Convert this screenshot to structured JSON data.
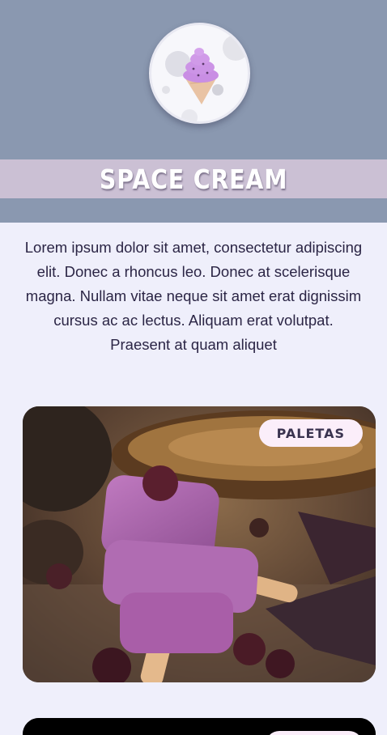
{
  "brand": {
    "title": "SPACE CREAM",
    "logo_icon": "ice-cream-moon-icon"
  },
  "intro": {
    "text": "Lorem ipsum dolor sit amet, consectetur adipiscing elit. Donec a rhoncus leo. Donec at scelerisque magna. Nullam vitae neque sit amet erat dignissim cursus ac ac lectus. Aliquam erat volutpat. Praesent at quam aliquet"
  },
  "cards": [
    {
      "badge": "PALETAS",
      "image": "berry-popsicles-photo"
    },
    {
      "badge": "",
      "image": "dark-product-photo"
    }
  ],
  "colors": {
    "header_bg": "#8a98b0",
    "title_band": "#cbc0d4",
    "page_bg": "#efeffb",
    "badge_bg": "#fbeefa"
  }
}
